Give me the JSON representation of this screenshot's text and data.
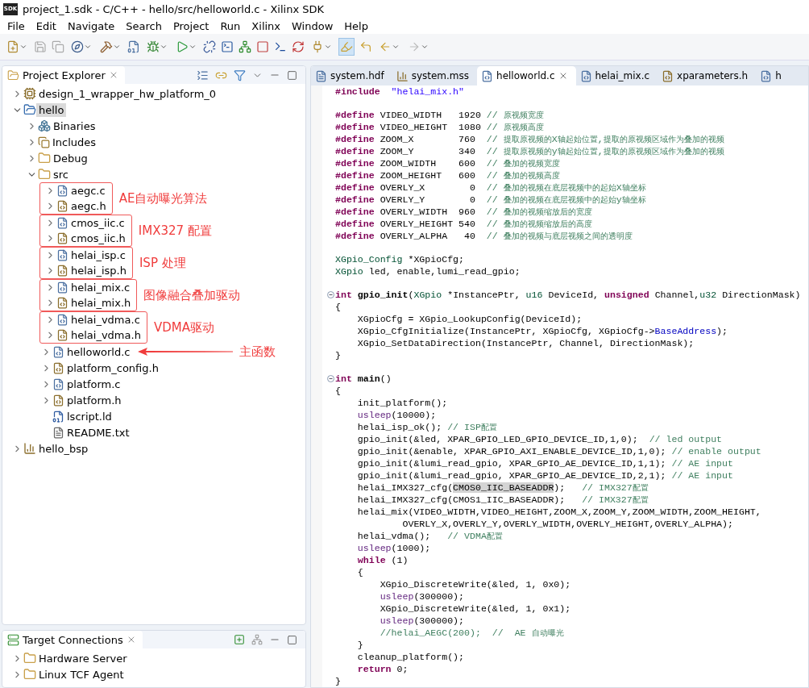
{
  "window": {
    "title": "project_1.sdk - C/C++ - hello/src/helloworld.c - Xilinx SDK",
    "logo": "SDK"
  },
  "menu": [
    "File",
    "Edit",
    "Navigate",
    "Search",
    "Project",
    "Run",
    "Xilinx",
    "Window",
    "Help"
  ],
  "project_explorer": {
    "title": "Project Explorer",
    "items": [
      {
        "label": "design_1_wrapper_hw_platform_0",
        "kind": "hw",
        "expanded": false,
        "selected": false
      },
      {
        "label": "hello",
        "kind": "project",
        "expanded": true,
        "selected": true,
        "children": [
          {
            "label": "Binaries",
            "kind": "binaries",
            "expanded": false,
            "selected": false
          },
          {
            "label": "Includes",
            "kind": "includes",
            "expanded": false,
            "selected": false
          },
          {
            "label": "Debug",
            "kind": "folder",
            "expanded": false,
            "selected": false
          },
          {
            "label": "src",
            "kind": "folder",
            "expanded": true,
            "selected": false,
            "children": [
              {
                "kind": "group",
                "note": "AE自动曝光算法",
                "children": [
                  {
                    "label": "aegc.c",
                    "kind": "c",
                    "expanded": false,
                    "selected": false
                  },
                  {
                    "label": "aegc.h",
                    "kind": "h",
                    "expanded": false,
                    "selected": false
                  }
                ]
              },
              {
                "kind": "group",
                "note": "IMX327 配置",
                "children": [
                  {
                    "label": "cmos_iic.c",
                    "kind": "c",
                    "expanded": false,
                    "selected": false
                  },
                  {
                    "label": "cmos_iic.h",
                    "kind": "h",
                    "expanded": false,
                    "selected": false
                  }
                ]
              },
              {
                "kind": "group",
                "note": "ISP 处理",
                "children": [
                  {
                    "label": "helai_isp.c",
                    "kind": "c",
                    "expanded": false,
                    "selected": false
                  },
                  {
                    "label": "helai_isp.h",
                    "kind": "h",
                    "expanded": false,
                    "selected": false
                  }
                ]
              },
              {
                "kind": "group",
                "note": "图像融合叠加驱动",
                "children": [
                  {
                    "label": "helai_mix.c",
                    "kind": "c",
                    "expanded": false,
                    "selected": false
                  },
                  {
                    "label": "helai_mix.h",
                    "kind": "h",
                    "expanded": false,
                    "selected": false
                  }
                ]
              },
              {
                "kind": "group",
                "note": "VDMA驱动",
                "children": [
                  {
                    "label": "helai_vdma.c",
                    "kind": "c",
                    "expanded": false,
                    "selected": false
                  },
                  {
                    "label": "helai_vdma.h",
                    "kind": "h",
                    "expanded": false,
                    "selected": false
                  }
                ]
              },
              {
                "label": "helloworld.c",
                "kind": "c",
                "expanded": false,
                "selected": false,
                "note": "主函数"
              },
              {
                "label": "platform_config.h",
                "kind": "h",
                "expanded": false,
                "selected": false
              },
              {
                "label": "platform.c",
                "kind": "c",
                "expanded": false,
                "selected": false
              },
              {
                "label": "platform.h",
                "kind": "h",
                "expanded": false,
                "selected": false
              },
              {
                "label": "lscript.ld",
                "kind": "ld",
                "selected": false
              },
              {
                "label": "README.txt",
                "kind": "txt",
                "selected": false
              }
            ]
          }
        ]
      },
      {
        "label": "hello_bsp",
        "kind": "bsp",
        "expanded": false,
        "selected": false
      }
    ]
  },
  "target_connections": {
    "title": "Target Connections",
    "items": [
      {
        "label": "Hardware Server",
        "expanded": false
      },
      {
        "label": "Linux TCF Agent",
        "expanded": false
      }
    ]
  },
  "editor": {
    "tabs": [
      {
        "label": "system.hdf",
        "kind": "hdf",
        "selected": false
      },
      {
        "label": "system.mss",
        "kind": "mss",
        "selected": false
      },
      {
        "label": "helloworld.c",
        "kind": "c",
        "selected": true
      },
      {
        "label": "helai_mix.c",
        "kind": "c",
        "selected": false
      },
      {
        "label": "xparameters.h",
        "kind": "h",
        "selected": false
      },
      {
        "label": "h",
        "kind": "c",
        "selected": false
      }
    ],
    "lines": [
      {
        "kind": "code",
        "tokens": [
          {
            "kind": "kw",
            "text": "#include"
          },
          {
            "kind": "string",
            "text": "  \"helai_mix.h\""
          }
        ]
      },
      {
        "kind": "blank"
      },
      {
        "kind": "code",
        "tokens": [
          {
            "kind": "kw",
            "text": "#define"
          },
          {
            "kind": "plain",
            "text": " VIDEO_WIDTH   1920 "
          },
          {
            "kind": "comment",
            "text": "// 原视频宽度"
          }
        ]
      },
      {
        "kind": "code",
        "tokens": [
          {
            "kind": "kw",
            "text": "#define"
          },
          {
            "kind": "plain",
            "text": " VIDEO_HEIGHT  1080 "
          },
          {
            "kind": "comment",
            "text": "// 原视频高度"
          }
        ]
      },
      {
        "kind": "code",
        "tokens": [
          {
            "kind": "kw",
            "text": "#define"
          },
          {
            "kind": "plain",
            "text": " ZOOM_X        760  "
          },
          {
            "kind": "comment",
            "text": "// 提取原视频的X轴起始位置,提取的原视频区域作为叠加的视频"
          }
        ]
      },
      {
        "kind": "code",
        "tokens": [
          {
            "kind": "kw",
            "text": "#define"
          },
          {
            "kind": "plain",
            "text": " ZOOM_Y        340  "
          },
          {
            "kind": "comment",
            "text": "// 提取原视频的y轴起始位置,提取的原视频区域作为叠加的视频"
          }
        ]
      },
      {
        "kind": "code",
        "tokens": [
          {
            "kind": "kw",
            "text": "#define"
          },
          {
            "kind": "plain",
            "text": " ZOOM_WIDTH    600  "
          },
          {
            "kind": "comment",
            "text": "// 叠加的视频宽度"
          }
        ]
      },
      {
        "kind": "code",
        "tokens": [
          {
            "kind": "kw",
            "text": "#define"
          },
          {
            "kind": "plain",
            "text": " ZOOM_HEIGHT   600  "
          },
          {
            "kind": "comment",
            "text": "// 叠加的视频高度"
          }
        ]
      },
      {
        "kind": "code",
        "tokens": [
          {
            "kind": "kw",
            "text": "#define"
          },
          {
            "kind": "plain",
            "text": " OVERLY_X        0  "
          },
          {
            "kind": "comment",
            "text": "// 叠加的视频在底层视频中的起始X轴坐标"
          }
        ]
      },
      {
        "kind": "code",
        "tokens": [
          {
            "kind": "kw",
            "text": "#define"
          },
          {
            "kind": "plain",
            "text": " OVERLY_Y        0  "
          },
          {
            "kind": "comment",
            "text": "// 叠加的视频在底层视频中的起始y轴坐标"
          }
        ]
      },
      {
        "kind": "code",
        "tokens": [
          {
            "kind": "kw",
            "text": "#define"
          },
          {
            "kind": "plain",
            "text": " OVERLY_WIDTH  960  "
          },
          {
            "kind": "comment",
            "text": "// 叠加的视频缩放后的宽度"
          }
        ]
      },
      {
        "kind": "code",
        "tokens": [
          {
            "kind": "kw",
            "text": "#define"
          },
          {
            "kind": "plain",
            "text": " OVERLY_HEIGHT 540  "
          },
          {
            "kind": "comment",
            "text": "// 叠加的视频缩放后的高度"
          }
        ]
      },
      {
        "kind": "code",
        "tokens": [
          {
            "kind": "kw",
            "text": "#define"
          },
          {
            "kind": "plain",
            "text": " OVERLY_ALPHA   40  "
          },
          {
            "kind": "comment",
            "text": "// 叠加的视频与底层视频之间的透明度"
          }
        ]
      },
      {
        "kind": "blank"
      },
      {
        "kind": "code",
        "tokens": [
          {
            "kind": "type",
            "text": "XGpio_Config"
          },
          {
            "kind": "plain",
            "text": " *XGpioCfg;"
          }
        ]
      },
      {
        "kind": "code",
        "tokens": [
          {
            "kind": "type",
            "text": "XGpio"
          },
          {
            "kind": "plain",
            "text": " led, enable,lumi_read_gpio;"
          }
        ]
      },
      {
        "kind": "blank"
      },
      {
        "kind": "definition",
        "tokens": [
          {
            "kind": "kw",
            "text": "int"
          },
          {
            "kind": "fn",
            "text": " gpio_init"
          },
          {
            "kind": "plain",
            "text": "("
          },
          {
            "kind": "type",
            "text": "XGpio"
          },
          {
            "kind": "plain",
            "text": " *InstancePtr, "
          },
          {
            "kind": "type",
            "text": "u16"
          },
          {
            "kind": "plain",
            "text": " DeviceId, "
          },
          {
            "kind": "kw",
            "text": "unsigned"
          },
          {
            "kind": "plain",
            "text": " Channel,"
          },
          {
            "kind": "type",
            "text": "u32"
          },
          {
            "kind": "plain",
            "text": " DirectionMask)"
          }
        ]
      },
      {
        "kind": "code",
        "tokens": [
          {
            "kind": "plain",
            "text": "{"
          }
        ]
      },
      {
        "kind": "code",
        "tokens": [
          {
            "kind": "plain",
            "text": "    XGpioCfg = XGpio_LookupConfig(DeviceId);"
          }
        ]
      },
      {
        "kind": "code",
        "tokens": [
          {
            "kind": "plain",
            "text": "    XGpio_CfgInitialize(InstancePtr, XGpioCfg, XGpioCfg->"
          },
          {
            "kind": "field",
            "text": "BaseAddress"
          },
          {
            "kind": "plain",
            "text": ");"
          }
        ]
      },
      {
        "kind": "code",
        "tokens": [
          {
            "kind": "plain",
            "text": "    XGpio_SetDataDirection(InstancePtr, Channel, DirectionMask);"
          }
        ]
      },
      {
        "kind": "code",
        "tokens": [
          {
            "kind": "plain",
            "text": "}"
          }
        ]
      },
      {
        "kind": "blank"
      },
      {
        "kind": "definition",
        "tokens": [
          {
            "kind": "kw",
            "text": "int"
          },
          {
            "kind": "fn",
            "text": " main"
          },
          {
            "kind": "plain",
            "text": "()"
          }
        ]
      },
      {
        "kind": "code",
        "tokens": [
          {
            "kind": "plain",
            "text": "{"
          }
        ]
      },
      {
        "kind": "code",
        "tokens": [
          {
            "kind": "plain",
            "text": "    init_platform();"
          }
        ]
      },
      {
        "kind": "code",
        "tokens": [
          {
            "kind": "macro",
            "text": "    usleep"
          },
          {
            "kind": "plain",
            "text": "(10000);"
          }
        ]
      },
      {
        "kind": "code",
        "tokens": [
          {
            "kind": "plain",
            "text": "    helai_isp_ok(); "
          },
          {
            "kind": "comment",
            "text": "// ISP配置"
          }
        ]
      },
      {
        "kind": "code",
        "tokens": [
          {
            "kind": "plain",
            "text": "    gpio_init(&led, XPAR_GPIO_LED_GPIO_DEVICE_ID,1,0);  "
          },
          {
            "kind": "comment",
            "text": "// led output"
          }
        ]
      },
      {
        "kind": "code",
        "tokens": [
          {
            "kind": "plain",
            "text": "    gpio_init(&enable, XPAR_GPIO_AXI_ENABLE_DEVICE_ID,1,0); "
          },
          {
            "kind": "comment",
            "text": "// enable output"
          }
        ]
      },
      {
        "kind": "code",
        "tokens": [
          {
            "kind": "plain",
            "text": "    gpio_init(&lumi_read_gpio, XPAR_GPIO_AE_DEVICE_ID,1,1); "
          },
          {
            "kind": "comment",
            "text": "// AE input"
          }
        ]
      },
      {
        "kind": "code",
        "tokens": [
          {
            "kind": "plain",
            "text": "    gpio_init(&lumi_read_gpio, XPAR_GPIO_AE_DEVICE_ID,2,1); "
          },
          {
            "kind": "comment",
            "text": "// AE input"
          }
        ]
      },
      {
        "kind": "code",
        "tokens": [
          {
            "kind": "plain",
            "text": "    helai_IMX327_cfg("
          },
          {
            "kind": "highlight",
            "text": "CMOS0_IIC_BASEADDR"
          },
          {
            "kind": "plain",
            "text": ");   "
          },
          {
            "kind": "comment",
            "text": "// IMX327配置"
          }
        ]
      },
      {
        "kind": "code",
        "tokens": [
          {
            "kind": "plain",
            "text": "    helai_IMX327_cfg(CMOS1_IIC_BASEADDR);   "
          },
          {
            "kind": "comment",
            "text": "// IMX327配置"
          }
        ]
      },
      {
        "kind": "code",
        "tokens": [
          {
            "kind": "plain",
            "text": "    helai_mix(VIDEO_WIDTH,VIDEO_HEIGHT,ZOOM_X,ZOOM_Y,ZOOM_WIDTH,ZOOM_HEIGHT,"
          }
        ]
      },
      {
        "kind": "code",
        "tokens": [
          {
            "kind": "plain",
            "text": "            OVERLY_X,OVERLY_Y,OVERLY_WIDTH,OVERLY_HEIGHT,OVERLY_ALPHA);"
          }
        ]
      },
      {
        "kind": "code",
        "tokens": [
          {
            "kind": "plain",
            "text": "    helai_vdma();   "
          },
          {
            "kind": "comment",
            "text": "// VDMA配置"
          }
        ]
      },
      {
        "kind": "code",
        "tokens": [
          {
            "kind": "macro",
            "text": "    usleep"
          },
          {
            "kind": "plain",
            "text": "(1000);"
          }
        ]
      },
      {
        "kind": "code",
        "tokens": [
          {
            "kind": "kw",
            "text": "    while"
          },
          {
            "kind": "plain",
            "text": " (1)"
          }
        ]
      },
      {
        "kind": "code",
        "tokens": [
          {
            "kind": "plain",
            "text": "    {"
          }
        ]
      },
      {
        "kind": "code",
        "tokens": [
          {
            "kind": "plain",
            "text": "        XGpio_DiscreteWrite(&led, 1, 0x0);"
          }
        ]
      },
      {
        "kind": "code",
        "tokens": [
          {
            "kind": "macro",
            "text": "        usleep"
          },
          {
            "kind": "plain",
            "text": "(300000);"
          }
        ]
      },
      {
        "kind": "code",
        "tokens": [
          {
            "kind": "plain",
            "text": "        XGpio_DiscreteWrite(&led, 1, 0x1);"
          }
        ]
      },
      {
        "kind": "code",
        "tokens": [
          {
            "kind": "macro",
            "text": "        usleep"
          },
          {
            "kind": "plain",
            "text": "(300000);"
          }
        ]
      },
      {
        "kind": "code",
        "tokens": [
          {
            "kind": "comment",
            "text": "        //helai_AEGC(200);  //  AE 自动曝光"
          }
        ]
      },
      {
        "kind": "code",
        "tokens": [
          {
            "kind": "plain",
            "text": "    }"
          }
        ]
      },
      {
        "kind": "code",
        "tokens": [
          {
            "kind": "plain",
            "text": "    cleanup_platform();"
          }
        ]
      },
      {
        "kind": "code",
        "tokens": [
          {
            "kind": "kw",
            "text": "    return"
          },
          {
            "kind": "plain",
            "text": " 0;"
          }
        ]
      },
      {
        "kind": "code",
        "tokens": [
          {
            "kind": "plain",
            "text": "}"
          }
        ]
      }
    ]
  }
}
